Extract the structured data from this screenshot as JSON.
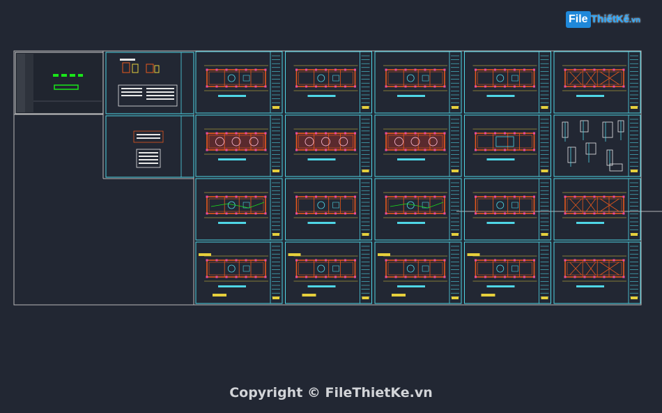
{
  "watermark": {
    "logo_file": "File",
    "logo_rest": "ThiếtKế",
    "logo_domain": ".vn",
    "copyright": "Copyright © FileThietKe.vn"
  },
  "colors": {
    "background": "#222733",
    "frame": "#4fd6e6",
    "border_gray": "#b9b9b9",
    "wall": "#e8581c",
    "dim": "#e6cf3c",
    "accent_green": "#19e619",
    "text_white": "#e9e9e9"
  },
  "grid": {
    "columns": 5,
    "rows": 4,
    "sheets": [
      {
        "row": 0,
        "col": 0,
        "kind": "plan",
        "variant": "plain"
      },
      {
        "row": 0,
        "col": 1,
        "kind": "plan",
        "variant": "plain"
      },
      {
        "row": 0,
        "col": 2,
        "kind": "plan",
        "variant": "plain"
      },
      {
        "row": 0,
        "col": 3,
        "kind": "plan",
        "variant": "plain"
      },
      {
        "row": 0,
        "col": 4,
        "kind": "plan",
        "variant": "cross"
      },
      {
        "row": 1,
        "col": 0,
        "kind": "plan",
        "variant": "tiled"
      },
      {
        "row": 1,
        "col": 1,
        "kind": "plan",
        "variant": "tiled"
      },
      {
        "row": 1,
        "col": 2,
        "kind": "plan",
        "variant": "tiled"
      },
      {
        "row": 1,
        "col": 3,
        "kind": "plan",
        "variant": "dark"
      },
      {
        "row": 1,
        "col": 4,
        "kind": "details",
        "variant": "details"
      },
      {
        "row": 2,
        "col": 0,
        "kind": "plan",
        "variant": "wiring"
      },
      {
        "row": 2,
        "col": 1,
        "kind": "plan",
        "variant": "plain"
      },
      {
        "row": 2,
        "col": 2,
        "kind": "plan",
        "variant": "wiring"
      },
      {
        "row": 2,
        "col": 3,
        "kind": "plan",
        "variant": "plain"
      },
      {
        "row": 2,
        "col": 4,
        "kind": "plan",
        "variant": "cross"
      },
      {
        "row": 3,
        "col": 0,
        "kind": "plan",
        "variant": "legend"
      },
      {
        "row": 3,
        "col": 1,
        "kind": "plan",
        "variant": "legend"
      },
      {
        "row": 3,
        "col": 2,
        "kind": "plan",
        "variant": "legend"
      },
      {
        "row": 3,
        "col": 3,
        "kind": "plan",
        "variant": "legend"
      },
      {
        "row": 3,
        "col": 4,
        "kind": "plan",
        "variant": "cross"
      }
    ]
  }
}
